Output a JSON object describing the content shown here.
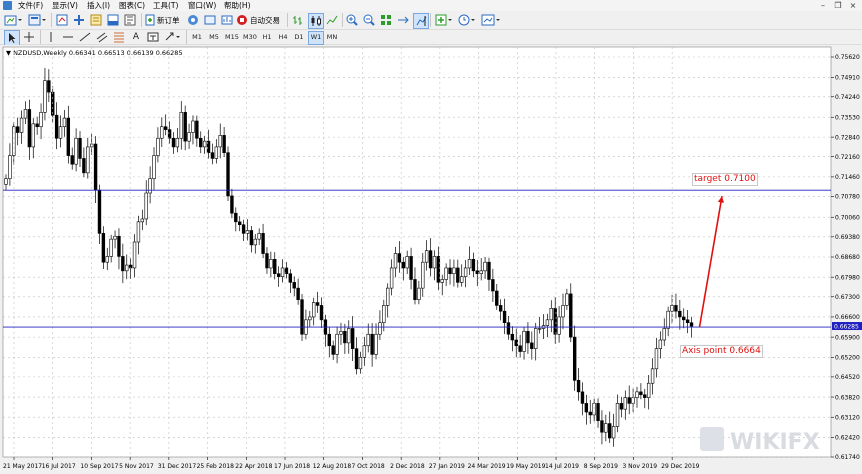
{
  "menubar": {
    "items": [
      "文件(F)",
      "显示(V)",
      "插入(I)",
      "图表(C)",
      "工具(T)",
      "窗口(W)",
      "帮助(H)"
    ]
  },
  "toolbar": {
    "new_order_label": "新订单",
    "auto_trading_label": "自动交易",
    "timeframes": [
      "M1",
      "M5",
      "M15",
      "M30",
      "H1",
      "H4",
      "D1",
      "W1",
      "MN"
    ]
  },
  "chart": {
    "header": "NZDUSD,Weekly  0.66341 0.66513 0.66139 0.66285",
    "current_price_label": "0.66285",
    "annotation_target": "target  0.7100",
    "annotation_axis": "Axis point 0.6664",
    "watermark": "WIKIFX",
    "colors": {
      "background": "#ffffff",
      "grid": "#c0c0c0",
      "candle": "#000000",
      "hline": "#2020c0",
      "arrow": "#e01010",
      "price_tag": "#2020c0"
    }
  },
  "chart_data": {
    "type": "candlestick",
    "symbol": "NZDUSD",
    "timeframe": "Weekly",
    "ylim": [
      0.6174,
      0.7562
    ],
    "y_ticks": [
      "0.75620",
      "0.74910",
      "0.74240",
      "0.73530",
      "0.72840",
      "0.72160",
      "0.71460",
      "0.70780",
      "0.70060",
      "0.69380",
      "0.68680",
      "0.67980",
      "0.67300",
      "0.66600",
      "0.65900",
      "0.65200",
      "0.64520",
      "0.63820",
      "0.63120",
      "0.62420",
      "0.61740"
    ],
    "x_ticks": [
      "21 May 2017",
      "16 Jul 2017",
      "10 Sep 2017",
      "5 Nov 2017",
      "31 Dec 2017",
      "25 Feb 2018",
      "22 Apr 2018",
      "17 Jun 2018",
      "12 Aug 2018",
      "7 Oct 2018",
      "2 Dec 2018",
      "27 Jan 2019",
      "24 Mar 2019",
      "19 May 2019",
      "14 Jul 2019",
      "8 Sep 2019",
      "3 Nov 2019",
      "29 Dec 2019"
    ],
    "horizontal_lines": [
      0.71,
      0.6625
    ],
    "last_close": 0.66285,
    "close": [
      0.714,
      0.722,
      0.732,
      0.73,
      0.735,
      0.738,
      0.725,
      0.733,
      0.732,
      0.737,
      0.748,
      0.744,
      0.736,
      0.728,
      0.732,
      0.735,
      0.722,
      0.719,
      0.728,
      0.721,
      0.716,
      0.725,
      0.726,
      0.71,
      0.695,
      0.685,
      0.687,
      0.693,
      0.694,
      0.687,
      0.682,
      0.684,
      0.683,
      0.692,
      0.699,
      0.7,
      0.709,
      0.714,
      0.722,
      0.728,
      0.732,
      0.731,
      0.728,
      0.725,
      0.728,
      0.737,
      0.727,
      0.73,
      0.734,
      0.728,
      0.725,
      0.727,
      0.723,
      0.721,
      0.725,
      0.729,
      0.723,
      0.708,
      0.702,
      0.699,
      0.698,
      0.695,
      0.696,
      0.691,
      0.693,
      0.695,
      0.688,
      0.683,
      0.686,
      0.681,
      0.68,
      0.683,
      0.681,
      0.678,
      0.676,
      0.672,
      0.66,
      0.665,
      0.666,
      0.671,
      0.67,
      0.665,
      0.66,
      0.656,
      0.653,
      0.66,
      0.661,
      0.657,
      0.662,
      0.655,
      0.648,
      0.652,
      0.656,
      0.66,
      0.653,
      0.66,
      0.664,
      0.67,
      0.676,
      0.683,
      0.688,
      0.685,
      0.683,
      0.687,
      0.679,
      0.672,
      0.676,
      0.685,
      0.689,
      0.683,
      0.687,
      0.678,
      0.679,
      0.683,
      0.681,
      0.683,
      0.678,
      0.68,
      0.683,
      0.686,
      0.682,
      0.681,
      0.682,
      0.685,
      0.679,
      0.675,
      0.67,
      0.668,
      0.664,
      0.66,
      0.658,
      0.656,
      0.654,
      0.661,
      0.657,
      0.655,
      0.662,
      0.662,
      0.663,
      0.665,
      0.669,
      0.66,
      0.666,
      0.67,
      0.674,
      0.659,
      0.644,
      0.64,
      0.636,
      0.633,
      0.632,
      0.636,
      0.63,
      0.626,
      0.629,
      0.624,
      0.628,
      0.636,
      0.634,
      0.638,
      0.636,
      0.638,
      0.64,
      0.639,
      0.638,
      0.643,
      0.648,
      0.655,
      0.658,
      0.662,
      0.668,
      0.67,
      0.668,
      0.666,
      0.665,
      0.664,
      0.6628
    ]
  }
}
